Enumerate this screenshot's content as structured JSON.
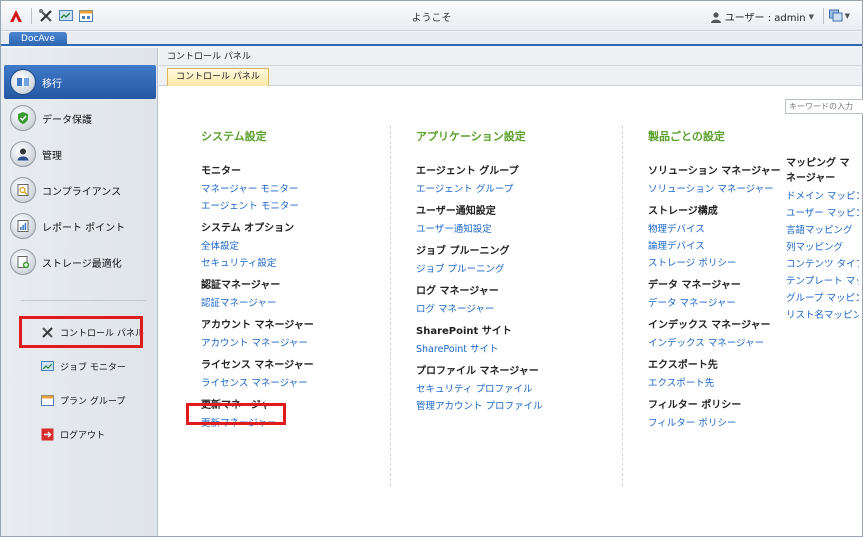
{
  "window": {
    "title": "ようこそ",
    "user_label": "ユーザー : admin"
  },
  "top_tab": "DocAve",
  "sidebar": {
    "items": [
      {
        "label": "移行",
        "active": true
      },
      {
        "label": "データ保護"
      },
      {
        "label": "管理"
      },
      {
        "label": "コンプライアンス"
      },
      {
        "label": "レポート ポイント"
      },
      {
        "label": "ストレージ最適化"
      }
    ],
    "sub_items": [
      {
        "label": "コントロール パネル"
      },
      {
        "label": "ジョブ モニター"
      },
      {
        "label": "プラン グループ"
      },
      {
        "label": "ログアウト"
      }
    ]
  },
  "main": {
    "breadcrumb": "コントロール パネル",
    "tab": "コントロール パネル",
    "search_placeholder": "キーワードの入力",
    "columns": [
      {
        "title": "システム設定",
        "groups": [
          {
            "heading": "モニター",
            "links": [
              "マネージャー モニター",
              "エージェント モニター"
            ]
          },
          {
            "heading": "システム オプション",
            "links": [
              "全体設定",
              "セキュリティ設定"
            ]
          },
          {
            "heading": "認証マネージャー",
            "links": [
              "認証マネージャー"
            ]
          },
          {
            "heading": "アカウント マネージャー",
            "links": [
              "アカウント マネージャー"
            ]
          },
          {
            "heading": "ライセンス マネージャー",
            "links": [
              "ライセンス マネージャー"
            ]
          },
          {
            "heading": "更新マネージャー",
            "links": [
              "更新マネージャー"
            ]
          }
        ]
      },
      {
        "title": "アプリケーション設定",
        "groups": [
          {
            "heading": "エージェント グループ",
            "links": [
              "エージェント グループ"
            ]
          },
          {
            "heading": "ユーザー通知設定",
            "links": [
              "ユーザー通知設定"
            ]
          },
          {
            "heading": "ジョブ プルーニング",
            "links": [
              "ジョブ プルーニング"
            ]
          },
          {
            "heading": "ログ マネージャー",
            "links": [
              "ログ マネージャー"
            ]
          },
          {
            "heading": "SharePoint サイト",
            "links": [
              "SharePoint サイト"
            ]
          },
          {
            "heading": "プロファイル マネージャー",
            "links": [
              "セキュリティ プロファイル",
              "管理アカウント プロファイル"
            ]
          }
        ]
      },
      {
        "title": "製品ごとの設定",
        "groups": [
          {
            "heading": "ソリューション マネージャー",
            "links": [
              "ソリューション マネージャー"
            ]
          },
          {
            "heading": "ストレージ構成",
            "links": [
              "物理デバイス",
              "論理デバイス",
              "ストレージ ポリシー"
            ]
          },
          {
            "heading": "データ マネージャー",
            "links": [
              "データ マネージャー"
            ]
          },
          {
            "heading": "インデックス マネージャー",
            "links": [
              "インデックス マネージャー"
            ]
          },
          {
            "heading": "エクスポート先",
            "links": [
              "エクスポート先"
            ]
          },
          {
            "heading": "フィルター ポリシー",
            "links": [
              "フィルター ポリシー"
            ]
          }
        ]
      },
      {
        "title": "",
        "groups": [
          {
            "heading": "マッピング マネージャー",
            "links": [
              "ドメイン マッピング",
              "ユーザー マッピング",
              "言語マッピング",
              "列マッピング",
              "コンテンツ タイプ マッピング",
              "テンプレート マッピング",
              "グループ マッピング",
              "リスト名マッピング"
            ]
          }
        ]
      }
    ]
  }
}
